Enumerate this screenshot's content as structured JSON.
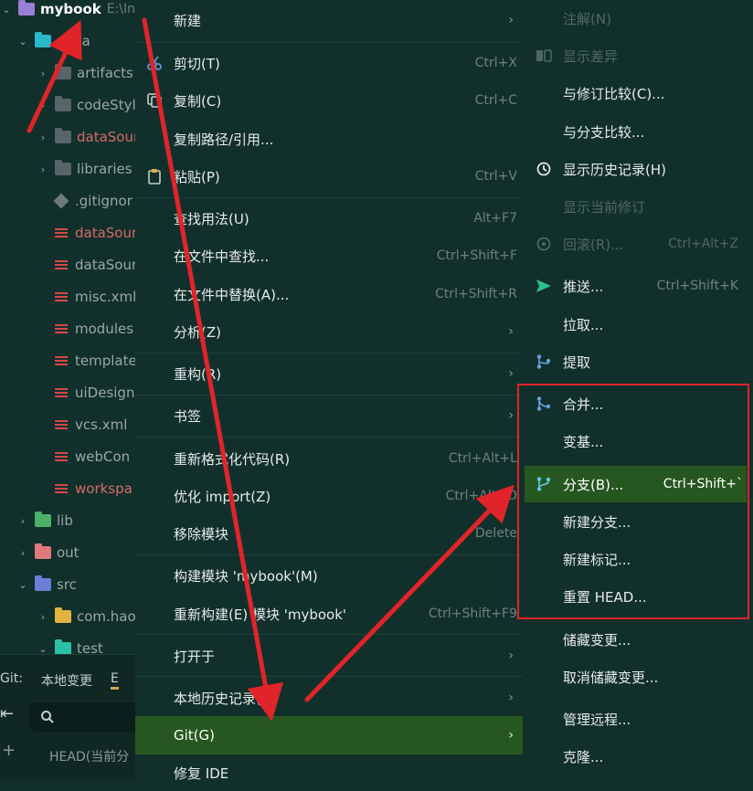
{
  "tree": {
    "root": {
      "label": "mybook",
      "path": "E:\\Int"
    },
    "items": [
      {
        "label": ".idea"
      },
      {
        "label": "artifacts"
      },
      {
        "label": "codeStyl"
      },
      {
        "label": "dataSour"
      },
      {
        "label": "libraries"
      },
      {
        "label": ".gitignor"
      },
      {
        "label": "dataSour"
      },
      {
        "label": "dataSour"
      },
      {
        "label": "misc.xml"
      },
      {
        "label": "modules"
      },
      {
        "label": "template"
      },
      {
        "label": "uiDesign"
      },
      {
        "label": "vcs.xml"
      },
      {
        "label": "webCon"
      },
      {
        "label": "workspa"
      },
      {
        "label": "lib"
      },
      {
        "label": "out"
      },
      {
        "label": "src"
      },
      {
        "label": "com.hao"
      },
      {
        "label": "test"
      }
    ]
  },
  "git_panel": {
    "tabs": [
      "Git:",
      "本地变更",
      "E"
    ],
    "head": "HEAD(当前分"
  },
  "context_menu": {
    "items": [
      {
        "label": "新建",
        "shortcut": "",
        "submenu": true
      },
      {
        "label": "剪切(T)",
        "shortcut": "Ctrl+X"
      },
      {
        "label": "复制(C)",
        "shortcut": "Ctrl+C"
      },
      {
        "label": "复制路径/引用...",
        "shortcut": ""
      },
      {
        "label": "粘贴(P)",
        "shortcut": "Ctrl+V"
      },
      {
        "label": "查找用法(U)",
        "shortcut": "Alt+F7"
      },
      {
        "label": "在文件中查找...",
        "shortcut": "Ctrl+Shift+F"
      },
      {
        "label": "在文件中替换(A)...",
        "shortcut": "Ctrl+Shift+R"
      },
      {
        "label": "分析(Z)",
        "shortcut": "",
        "submenu": true
      },
      {
        "label": "重构(R)",
        "shortcut": "",
        "submenu": true
      },
      {
        "label": "书签",
        "shortcut": "",
        "submenu": true
      },
      {
        "label": "重新格式化代码(R)",
        "shortcut": "Ctrl+Alt+L"
      },
      {
        "label": "优化 import(Z)",
        "shortcut": "Ctrl+Alt+O"
      },
      {
        "label": "移除模块",
        "shortcut": "Delete"
      },
      {
        "label": "构建模块 'mybook'(M)",
        "shortcut": ""
      },
      {
        "label": "重新构建(E) 模块 'mybook'",
        "shortcut": "Ctrl+Shift+F9"
      },
      {
        "label": "打开于",
        "shortcut": "",
        "submenu": true
      },
      {
        "label": "本地历史记录(H)",
        "shortcut": "",
        "submenu": true
      },
      {
        "label": "Git(G)",
        "shortcut": "",
        "submenu": true,
        "active": true
      },
      {
        "label": "修复 IDE",
        "shortcut": ""
      }
    ]
  },
  "git_submenu": {
    "items": [
      {
        "label": "注解(N)",
        "shortcut": "",
        "disabled": true
      },
      {
        "label": "显示差异",
        "shortcut": "",
        "disabled": true
      },
      {
        "label": "与修订比较(C)...",
        "shortcut": ""
      },
      {
        "label": "与分支比较...",
        "shortcut": ""
      },
      {
        "label": "显示历史记录(H)",
        "shortcut": ""
      },
      {
        "label": "显示当前修订",
        "shortcut": "",
        "disabled": true
      },
      {
        "label": "回滚(R)...",
        "shortcut": "Ctrl+Alt+Z",
        "disabled": true
      },
      {
        "label": "推送...",
        "shortcut": "Ctrl+Shift+K"
      },
      {
        "label": "拉取...",
        "shortcut": ""
      },
      {
        "label": "提取",
        "shortcut": ""
      },
      {
        "label": "合并...",
        "shortcut": ""
      },
      {
        "label": "变基...",
        "shortcut": ""
      },
      {
        "label": "分支(B)...",
        "shortcut": "Ctrl+Shift+`",
        "active": true
      },
      {
        "label": "新建分支...",
        "shortcut": ""
      },
      {
        "label": "新建标记...",
        "shortcut": ""
      },
      {
        "label": "重置 HEAD...",
        "shortcut": ""
      },
      {
        "label": "储藏变更...",
        "shortcut": ""
      },
      {
        "label": "取消储藏变更...",
        "shortcut": ""
      },
      {
        "label": "管理远程...",
        "shortcut": ""
      },
      {
        "label": "克隆...",
        "shortcut": ""
      }
    ]
  },
  "colors": {
    "background": "#12302b",
    "active_item": "#275720",
    "annotation_red": "#e0242a"
  }
}
